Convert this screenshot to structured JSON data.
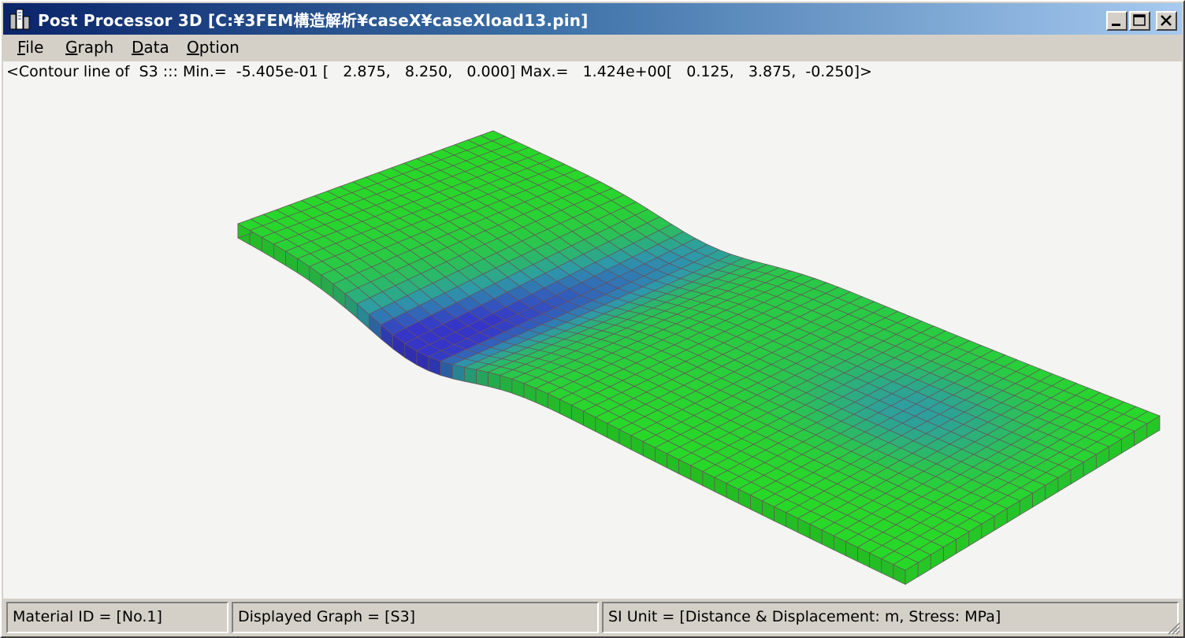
{
  "window": {
    "title": "Post Processor 3D [C:¥3FEM構造解析¥caseX¥caseXload13.pin]",
    "controls": {
      "minimize": "minimize",
      "maximize": "maximize",
      "close": "close"
    }
  },
  "menu": {
    "items": [
      {
        "mnemonic": "F",
        "rest": "ile"
      },
      {
        "mnemonic": "G",
        "rest": "raph"
      },
      {
        "mnemonic": "D",
        "rest": "ata"
      },
      {
        "mnemonic": "O",
        "rest": "ption"
      }
    ]
  },
  "plot": {
    "header": "<Contour line of  S3 ::: Min.=  -5.405e-01 [   2.875,   8.250,   0.000] Max.=   1.424e+00[   0.125,   3.875,  -0.250]>",
    "quantity": "S3",
    "min_value": "-5.405e-01",
    "min_location": "2.875, 8.250, 0.000",
    "max_value": "1.424e+00",
    "max_location": "0.125, 3.875, -0.250",
    "colors": {
      "background": "#f4f4f2",
      "high": "#28d828",
      "mid": "#2e9aa8",
      "low": "#3535c8",
      "mesh_lines": "#6a4f5c"
    }
  },
  "status": {
    "material": "Material ID = [No.1]",
    "graph": "Displayed Graph = [S3]",
    "units": "SI Unit = [Distance & Displacement: m, Stress: MPa]"
  }
}
